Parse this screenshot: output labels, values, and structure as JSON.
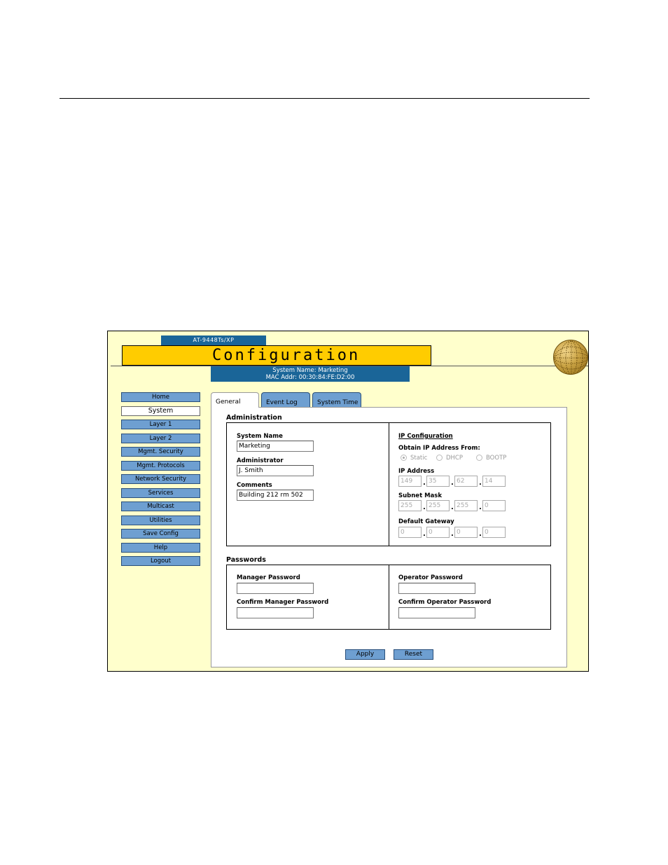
{
  "header": {
    "model": "AT-9448Ts/XP",
    "title": "Configuration",
    "system_name": "System Name: Marketing",
    "mac_addr": "MAC Addr: 00:30:84:FE:D2:00"
  },
  "nav": {
    "items": [
      "Home",
      "System",
      "Layer 1",
      "Layer 2",
      "Mgmt. Security",
      "Mgmt. Protocols",
      "Network Security",
      "Services",
      "Multicast",
      "Utilities",
      "Save Config",
      "Help",
      "Logout"
    ],
    "active": "System"
  },
  "tabs": [
    "General",
    "Event Log",
    "System Time"
  ],
  "administration": {
    "title": "Administration",
    "system_name_label": "System Name",
    "system_name_value": "Marketing",
    "administrator_label": "Administrator",
    "administrator_value": "J. Smith",
    "comments_label": "Comments",
    "comments_value": "Building 212 rm 502"
  },
  "ip_config": {
    "title": "IP Configuration",
    "obtain_label": "Obtain IP Address From:",
    "options": [
      "Static",
      "DHCP",
      "BOOTP"
    ],
    "selected": "Static",
    "ip_label": "IP Address",
    "ip": [
      "149",
      "35",
      "62",
      "14"
    ],
    "mask_label": "Subnet Mask",
    "mask": [
      "255",
      "255",
      "255",
      "0"
    ],
    "gateway_label": "Default Gateway",
    "gateway": [
      "0",
      "0",
      "0",
      "0"
    ]
  },
  "passwords": {
    "title": "Passwords",
    "manager_label": "Manager Password",
    "confirm_manager_label": "Confirm Manager Password",
    "operator_label": "Operator Password",
    "confirm_operator_label": "Confirm Operator Password"
  },
  "buttons": {
    "apply": "Apply",
    "reset": "Reset"
  }
}
